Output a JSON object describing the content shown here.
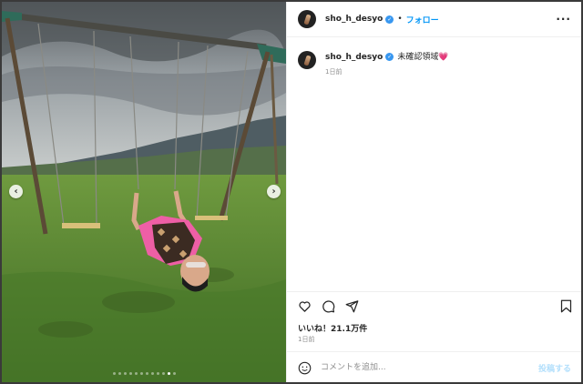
{
  "post": {
    "username": "sho_h_desyo",
    "follow_label": "フォロー",
    "separator": "•",
    "more_label": "···",
    "caption": "未確認領域",
    "caption_emoji": "💗",
    "caption_time": "1日前",
    "likes": "いいね！21.1万件",
    "post_time": "1日前"
  },
  "comment": {
    "placeholder": "コメントを追加...",
    "post_label": "投稿する"
  },
  "carousel": {
    "prev": "‹",
    "next": "›",
    "slide_count": 12,
    "active_index": 10
  },
  "icons": [
    "heart-icon",
    "comment-icon",
    "share-icon",
    "bookmark-icon",
    "emoji-icon",
    "verified-badge-icon",
    "more-options-icon"
  ],
  "colors": {
    "accent": "#0095f6",
    "verified": "#3897f0",
    "heart": "#e1306c"
  }
}
